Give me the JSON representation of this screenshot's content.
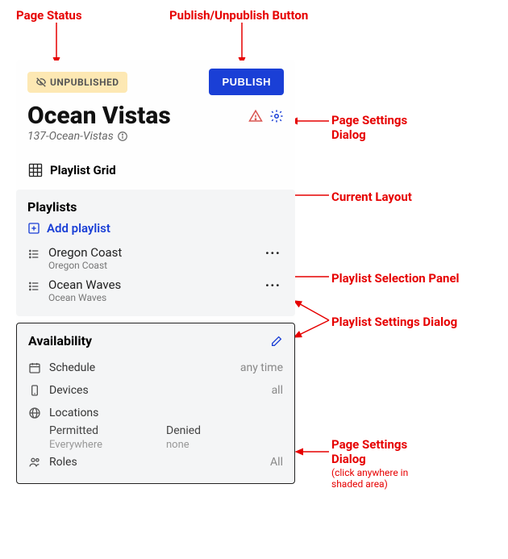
{
  "annotations": {
    "page_status": "Page Status",
    "publish_button": "Publish/Unpublish Button",
    "page_settings_top": "Page Settings\nDialog",
    "current_layout": "Current Layout",
    "playlist_selection": "Playlist Selection Panel",
    "playlist_settings": "Playlist Settings Dialog",
    "page_settings_bottom": "Page Settings\nDialog",
    "page_settings_bottom_sub": "(click anywhere in\nshaded area)"
  },
  "header": {
    "status_text": "UNPUBLISHED",
    "publish_label": "PUBLISH"
  },
  "page": {
    "title": "Ocean Vistas",
    "slug": "137-Ocean-Vistas"
  },
  "layout": {
    "name": "Playlist Grid"
  },
  "playlists": {
    "title": "Playlists",
    "add_label": "Add playlist",
    "items": [
      {
        "name": "Oregon Coast",
        "sub": "Oregon Coast"
      },
      {
        "name": "Ocean Waves",
        "sub": "Ocean Waves"
      }
    ]
  },
  "availability": {
    "title": "Availability",
    "schedule_label": "Schedule",
    "schedule_value": "any time",
    "devices_label": "Devices",
    "devices_value": "all",
    "locations_label": "Locations",
    "permitted_label": "Permitted",
    "permitted_value": "Everywhere",
    "denied_label": "Denied",
    "denied_value": "none",
    "roles_label": "Roles",
    "roles_value": "All"
  }
}
